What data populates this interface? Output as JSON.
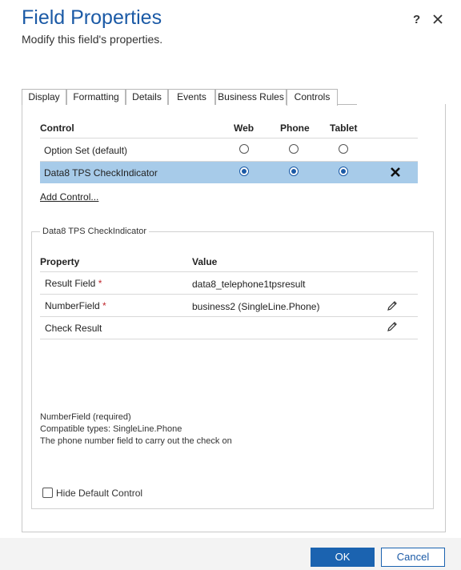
{
  "dialog": {
    "title": "Field Properties",
    "subtitle": "Modify this field's properties.",
    "help_label": "?"
  },
  "tabs": [
    {
      "label": "Display"
    },
    {
      "label": "Formatting"
    },
    {
      "label": "Details"
    },
    {
      "label": "Events"
    },
    {
      "label": "Business Rules"
    },
    {
      "label": "Controls",
      "active": true
    }
  ],
  "controls": {
    "headers": {
      "control": "Control",
      "web": "Web",
      "phone": "Phone",
      "tablet": "Tablet"
    },
    "rows": [
      {
        "name": "Option Set (default)",
        "web": false,
        "phone": false,
        "tablet": false,
        "selected": false
      },
      {
        "name": "Data8 TPS CheckIndicator",
        "web": true,
        "phone": true,
        "tablet": true,
        "selected": true
      }
    ],
    "add_link": "Add Control..."
  },
  "control_section": {
    "legend": "Data8 TPS CheckIndicator",
    "headers": {
      "property": "Property",
      "value": "Value"
    },
    "properties": [
      {
        "name": "Result Field",
        "required": true,
        "value": "data8_telephone1tpsresult",
        "editable": false
      },
      {
        "name": "NumberField",
        "required": true,
        "value": "business2 (SingleLine.Phone)",
        "editable": true
      },
      {
        "name": "Check Result",
        "required": false,
        "value": "",
        "editable": true
      }
    ],
    "description": {
      "line1": "NumberField (required)",
      "line2": "Compatible types: SingleLine.Phone",
      "line3": "The phone number field to carry out the check on"
    },
    "hide_default": {
      "label": "Hide Default Control",
      "checked": false
    },
    "required_marker": "*"
  },
  "footer": {
    "ok_label": "OK",
    "cancel_label": "Cancel"
  },
  "colors": {
    "accent": "#1b5aa6",
    "selected_row": "#a7cbe9",
    "required": "#c0272d"
  }
}
